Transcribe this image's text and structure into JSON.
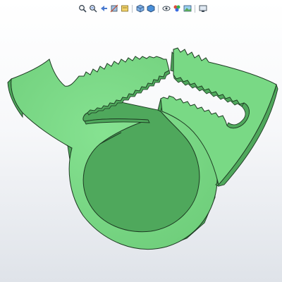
{
  "app": {
    "background_top": "#ffffff",
    "background_bottom": "#dfe3e9"
  },
  "heads_up_toolbar": {
    "buttons": [
      {
        "name": "zoom-to-fit-icon"
      },
      {
        "name": "zoom-to-area-icon"
      },
      {
        "name": "previous-view-icon"
      },
      {
        "name": "section-view-icon"
      },
      {
        "name": "dynamic-annotation-icon"
      },
      {
        "name": "view-orientation-icon"
      },
      {
        "name": "display-style-icon"
      },
      {
        "name": "hide-show-items-icon"
      },
      {
        "name": "edit-appearance-icon"
      },
      {
        "name": "apply-scene-icon"
      },
      {
        "name": "view-settings-icon"
      }
    ]
  },
  "model": {
    "name": "hose-clamp",
    "face_color": "#79d985",
    "side_color": "#4fa85c",
    "edge_color": "#1d3a22"
  }
}
